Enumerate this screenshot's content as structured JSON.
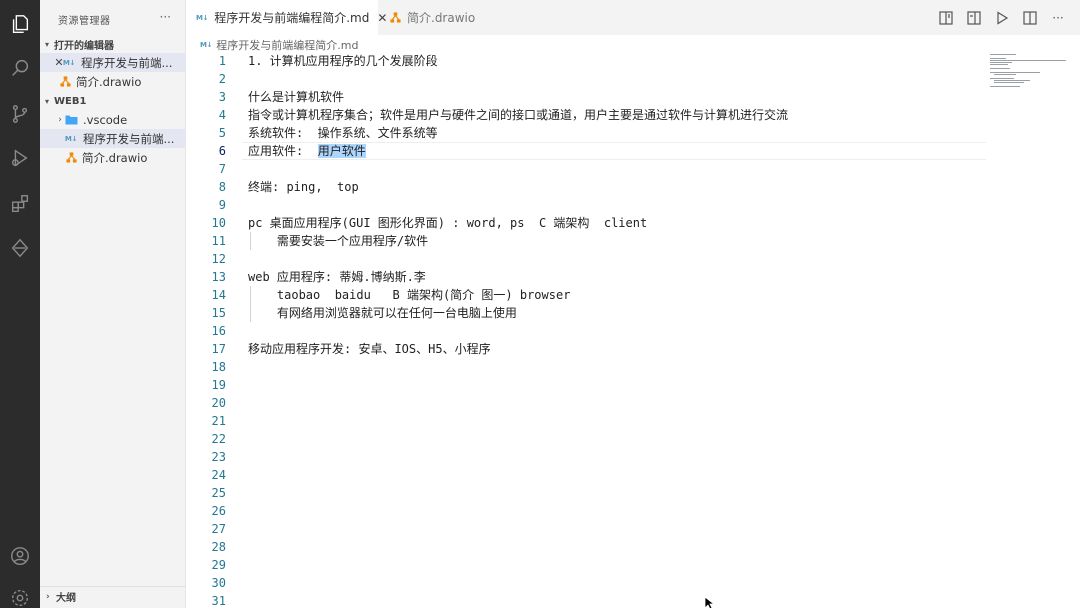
{
  "explorer": {
    "title": "资源管理器",
    "more": "···",
    "open_editors": {
      "label": "打开的编辑器",
      "items": [
        {
          "close": "✕",
          "badge": "M↓",
          "name": "程序开发与前端..."
        },
        {
          "name": "简介.drawio"
        }
      ]
    },
    "workspace": {
      "label": "WEB1",
      "items": [
        {
          "name": ".vscode"
        },
        {
          "badge": "M↓",
          "name": "程序开发与前端..."
        },
        {
          "name": "简介.drawio"
        }
      ]
    },
    "outline": "大纲"
  },
  "tabs": [
    {
      "badge": "M↓",
      "label": "程序开发与前端编程简介.md",
      "close": "✕"
    },
    {
      "label": "简介.drawio"
    }
  ],
  "breadcrumb": {
    "badge": "M↓",
    "label": "程序开发与前端编程简介.md"
  },
  "editor": {
    "lines": [
      {
        "n": "1",
        "text": "1. 计算机应用程序的几个发展阶段"
      },
      {
        "n": "2",
        "text": ""
      },
      {
        "n": "3",
        "text": "什么是计算机软件"
      },
      {
        "n": "4",
        "text": "指令或计算机程序集合；软件是用户与硬件之间的接口或通道，用户主要是通过软件与计算机进行交流"
      },
      {
        "n": "5",
        "text": "系统软件:  操作系统、文件系统等"
      },
      {
        "n": "6",
        "text": "应用软件:  ",
        "selected": "用户软件"
      },
      {
        "n": "7",
        "text": ""
      },
      {
        "n": "8",
        "text": "终端: ping,  top"
      },
      {
        "n": "9",
        "text": ""
      },
      {
        "n": "10",
        "text": "pc 桌面应用程序(GUI 图形化界面) : word, ps  C 端架构  client"
      },
      {
        "n": "11",
        "text": "    需要安装一个应用程序/软件"
      },
      {
        "n": "12",
        "text": ""
      },
      {
        "n": "13",
        "text": "web 应用程序: 蒂姆.博纳斯.李"
      },
      {
        "n": "14",
        "text": "    taobao  baidu   B 端架构(简介 图一) browser"
      },
      {
        "n": "15",
        "text": "    有网络用浏览器就可以在任何一台电脑上使用"
      },
      {
        "n": "16",
        "text": ""
      },
      {
        "n": "17",
        "text": "移动应用程序开发: 安卓、IOS、H5、小程序"
      },
      {
        "n": "18",
        "text": ""
      },
      {
        "n": "19",
        "text": ""
      },
      {
        "n": "20",
        "text": ""
      },
      {
        "n": "21",
        "text": ""
      },
      {
        "n": "22",
        "text": ""
      },
      {
        "n": "23",
        "text": ""
      },
      {
        "n": "24",
        "text": ""
      },
      {
        "n": "25",
        "text": ""
      },
      {
        "n": "26",
        "text": ""
      },
      {
        "n": "27",
        "text": ""
      },
      {
        "n": "28",
        "text": ""
      },
      {
        "n": "29",
        "text": ""
      },
      {
        "n": "30",
        "text": ""
      },
      {
        "n": "31",
        "text": ""
      }
    ],
    "current_line": 6
  },
  "colors": {
    "activity_bar": "#2c2c2c",
    "sidebar": "#f3f3f3",
    "line_number": "#237893",
    "selection": "#add6ff",
    "md_icon": "#519aba",
    "drawio_icon": "#f08705"
  }
}
